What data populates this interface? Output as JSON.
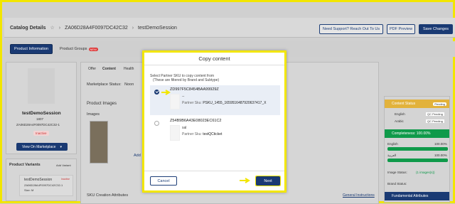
{
  "header": {
    "title": "Catalog Details",
    "sku_id": "ZA06D28A4F0097DC42C32",
    "session": "testDemoSession",
    "need_support": "Need Support? Reach Out To Us",
    "pdf_preview": "PDF Preview",
    "save_changes": "Save Changes"
  },
  "tabs": {
    "product_information": "Product Information",
    "product_groups": "Product Groups",
    "new_badge": "NEW"
  },
  "product_card": {
    "name": "testDemoSession",
    "code": "1807",
    "sku": "ZA06D28A4F0097DC42C32-1",
    "status": "Inactive",
    "view_on_marketplace": "View On Marketplace"
  },
  "variants": {
    "title": "Product Variants",
    "add_variant": "Add Variant",
    "item_name": "testDemoSession",
    "item_badge": "Inactive",
    "item_sku": "ZA06D28A4F0097DC42C32-1",
    "item_size": "Size: M"
  },
  "middle": {
    "subtabs": [
      "Offer",
      "Content",
      "Health"
    ],
    "marketplace_status_label": "Marketplace Status:",
    "marketplace_status_value": "Noon",
    "product_images": "Product Images",
    "images_label": "Images",
    "add_label": "Add",
    "sku_creation_attributes": "SKU Creation Attributes",
    "general_instructions": "General Instructions"
  },
  "right_panel": {
    "content_status": "Content Status",
    "pending": "Pending",
    "english": "English",
    "arabic": "Arabic",
    "qc_pending": "QC Pending",
    "completeness": "Completeness: 100.00%",
    "english_short": "English",
    "arabic_short": "العربية",
    "pct": "100.00%",
    "image_status_label": "Image Status:",
    "image_status_value": "(1 images(s))",
    "brand_status_label": "Brand Status:",
    "fundamental_attributes": "Fundamental Attributes"
  },
  "modal": {
    "title": "Copy content",
    "desc_line1": "Select Partner SKU to copy content from",
    "desc_line2": "(These are filtered by Brand and Subtype)",
    "options": [
      {
        "sku": "ZD997F5C8454BAA99929Z",
        "dash": "--",
        "partner_label": "Partner Sku:",
        "partner_value": "PSKU_1455_1659516487920637417_X",
        "selected": true
      },
      {
        "sku": "Z54B9B6A43E08023EC61C2",
        "dash": "sal",
        "partner_label": "Partner Sku:",
        "partner_value": "testQCticket",
        "selected": false
      }
    ],
    "cancel": "Cancel",
    "next": "Next"
  },
  "colors": {
    "primary": "#1a3a73",
    "highlight": "#f2e600",
    "success": "#0f9a4a",
    "warning": "#e2b23c"
  }
}
